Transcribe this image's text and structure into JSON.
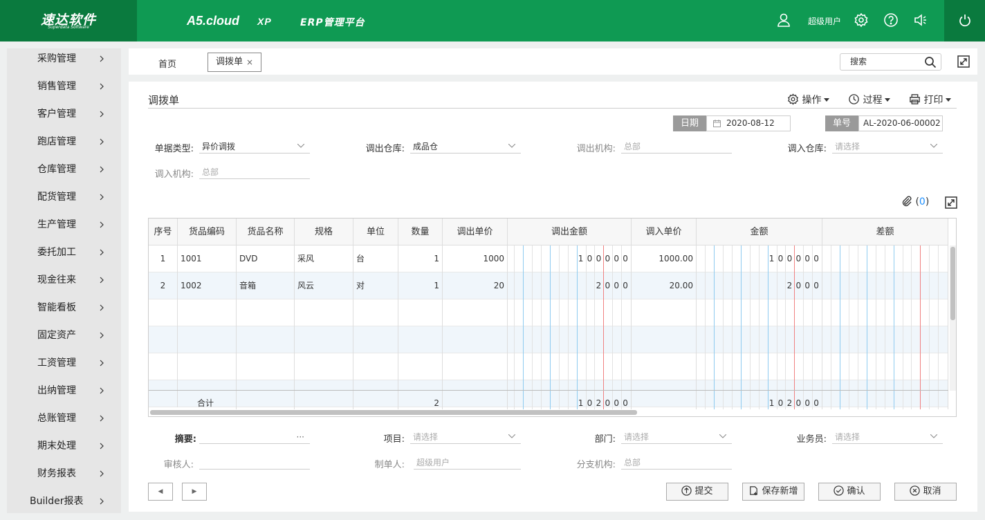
{
  "header": {
    "logo_main": "速达软件",
    "logo_sub": "Superdata Software",
    "brand_a5": "A5.cloud",
    "brand_xp": "XP",
    "brand_erp": "ERP管理平台",
    "user_name": "超级用户"
  },
  "sidebar": {
    "items": [
      {
        "label": "采购管理"
      },
      {
        "label": "销售管理"
      },
      {
        "label": "客户管理"
      },
      {
        "label": "跑店管理"
      },
      {
        "label": "仓库管理"
      },
      {
        "label": "配货管理"
      },
      {
        "label": "生产管理"
      },
      {
        "label": "委托加工"
      },
      {
        "label": "现金往来"
      },
      {
        "label": "智能看板"
      },
      {
        "label": "固定资产"
      },
      {
        "label": "工资管理"
      },
      {
        "label": "出纳管理"
      },
      {
        "label": "总账管理"
      },
      {
        "label": "期末处理"
      },
      {
        "label": "财务报表"
      },
      {
        "label": "Builder报表"
      }
    ]
  },
  "tabs": {
    "home": "首页",
    "active": "调拨单",
    "close": "×",
    "search_placeholder": "搜索"
  },
  "form": {
    "title": "调拨单",
    "actions": {
      "operate": "操作",
      "process": "过程",
      "print": "打印"
    },
    "date_label": "日期",
    "date_value": "2020-08-12",
    "number_label": "单号",
    "number_value": "AL-2020-06-00002",
    "doc_type_label": "单据类型:",
    "doc_type_value": "异价调拨",
    "out_wh_label": "调出仓库:",
    "out_wh_value": "成品仓",
    "out_org_label": "调出机构:",
    "out_org_value": "总部",
    "in_wh_label": "调入仓库:",
    "in_wh_placeholder": "请选择",
    "in_org_label": "调入机构:",
    "in_org_value": "总部",
    "attach_open": "(",
    "attach_count": "0",
    "attach_close": ")"
  },
  "grid": {
    "headers": [
      "序号",
      "货品编码",
      "货品名称",
      "规格",
      "单位",
      "数量",
      "调出单价",
      "调出金额",
      "调入单价",
      "金额",
      "差额"
    ],
    "rows": [
      {
        "no": "1",
        "code": "1001",
        "name": "DVD",
        "spec": "采风",
        "unit": "台",
        "qty": "1",
        "out_price": "1000",
        "out_amount": "100000",
        "in_price": "1000.00",
        "amount": "100000",
        "diff": ""
      },
      {
        "no": "2",
        "code": "1002",
        "name": "音箱",
        "spec": "风云",
        "unit": "对",
        "qty": "1",
        "out_price": "20",
        "out_amount": "2000",
        "in_price": "20.00",
        "amount": "2000",
        "diff": ""
      }
    ],
    "total": {
      "label": "合计",
      "qty": "2",
      "out_amount": "102000",
      "amount": "102000"
    }
  },
  "footer": {
    "summary_label": "摘要:",
    "summary_more": "···",
    "project_label": "项目:",
    "project_placeholder": "请选择",
    "dept_label": "部门:",
    "dept_placeholder": "请选择",
    "staff_label": "业务员:",
    "staff_placeholder": "请选择",
    "reviewer_label": "审核人:",
    "maker_label": "制单人:",
    "maker_value": "超级用户",
    "branch_label": "分支机构:",
    "branch_value": "总部",
    "prev": "◀",
    "next": "▶",
    "submit": "提交",
    "save_new": "保存新增",
    "confirm": "确认",
    "cancel": "取消"
  },
  "colors": {
    "brand_green": "#0f9a53",
    "brand_dark": "#0a7a3e",
    "link_blue": "#1e90ff"
  }
}
